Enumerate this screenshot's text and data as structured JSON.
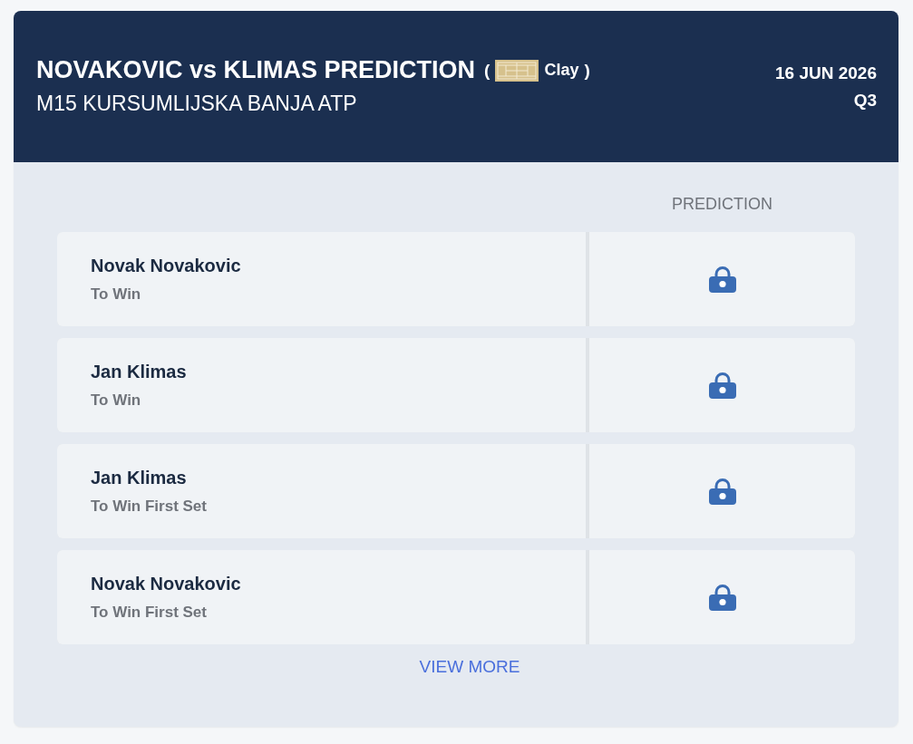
{
  "header": {
    "title": "NOVAKOVIC vs KLIMAS PREDICTION",
    "surface": {
      "open": "(",
      "label": "Clay",
      "close": ")"
    },
    "tournament": "M15 KURSUMLIJSKA BANJA ATP",
    "date": "16 JUN 2026",
    "round": "Q3"
  },
  "table": {
    "columns": [
      "PREDICTION"
    ],
    "rows": [
      {
        "player": "Novak Novakovic",
        "market": "To Win",
        "locked": true
      },
      {
        "player": "Jan Klimas",
        "market": "To Win",
        "locked": true
      },
      {
        "player": "Jan Klimas",
        "market": "To Win First Set",
        "locked": true
      },
      {
        "player": "Novak Novakovic",
        "market": "To Win First Set",
        "locked": true
      }
    ]
  },
  "view_more": "VIEW MORE"
}
